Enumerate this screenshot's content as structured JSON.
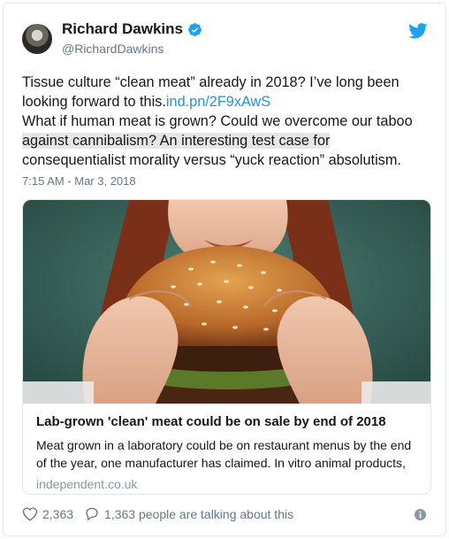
{
  "author": {
    "name": "Richard Dawkins",
    "handle": "@RichardDawkins"
  },
  "tweet": {
    "line1": "Tissue culture “clean meat” already in 2018? I’ve long been looking forward to this.",
    "link": "ind.pn/2F9xAwS",
    "line2": "What if human meat is grown? Could we overcome our taboo ",
    "highlighted": "against cannibalism? An interesting test case for",
    "line3": " consequentialist morality versus “yuck reaction” absolutism.",
    "timestamp": "7:15 AM - Mar 3, 2018"
  },
  "card": {
    "title": "Lab-grown 'clean' meat could be on sale by end of 2018",
    "description": "Meat grown in a laboratory could be on restaurant menus by the end of the year, one manufacturer has claimed.  In vitro animal products,",
    "domain": "independent.co.uk"
  },
  "footer": {
    "likes": "2,363",
    "talking": "1,363 people are talking about this"
  },
  "colors": {
    "link": "#1b95e0",
    "verified": "#1da1f2",
    "secondary": "#657786",
    "image_bg": "#3c6a64"
  }
}
